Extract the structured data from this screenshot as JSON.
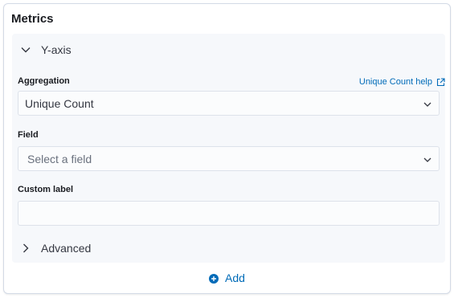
{
  "panel": {
    "title": "Metrics"
  },
  "yaxis": {
    "label": "Y-axis"
  },
  "aggregation": {
    "label": "Aggregation",
    "help_link": "Unique Count help",
    "selected": "Unique Count"
  },
  "field": {
    "label": "Field",
    "placeholder": "Select a field"
  },
  "custom_label": {
    "label": "Custom label",
    "value": ""
  },
  "advanced": {
    "label": "Advanced"
  },
  "add": {
    "label": "Add"
  },
  "colors": {
    "link": "#006bb8",
    "section_bg": "#f6f8fb",
    "border": "#d3dae6"
  },
  "icons": {
    "yaxis_toggle": "chevron-down-icon",
    "advanced_toggle": "chevron-right-icon",
    "help_external": "external-link-icon",
    "select_caret": "chevron-down-icon",
    "add": "plus-circle-icon"
  }
}
